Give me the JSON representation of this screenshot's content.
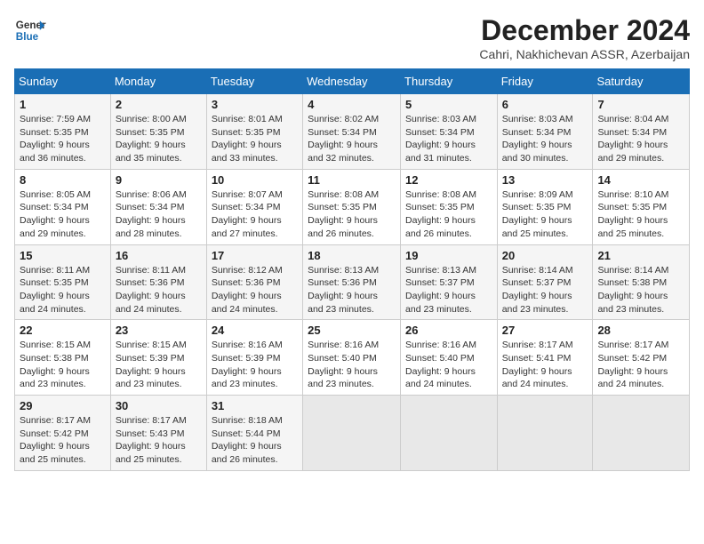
{
  "logo": {
    "line1": "General",
    "line2": "Blue"
  },
  "title": "December 2024",
  "location": "Cahri, Nakhichevan ASSR, Azerbaijan",
  "headers": [
    "Sunday",
    "Monday",
    "Tuesday",
    "Wednesday",
    "Thursday",
    "Friday",
    "Saturday"
  ],
  "weeks": [
    [
      {
        "day": "1",
        "info": "Sunrise: 7:59 AM\nSunset: 5:35 PM\nDaylight: 9 hours\nand 36 minutes."
      },
      {
        "day": "2",
        "info": "Sunrise: 8:00 AM\nSunset: 5:35 PM\nDaylight: 9 hours\nand 35 minutes."
      },
      {
        "day": "3",
        "info": "Sunrise: 8:01 AM\nSunset: 5:35 PM\nDaylight: 9 hours\nand 33 minutes."
      },
      {
        "day": "4",
        "info": "Sunrise: 8:02 AM\nSunset: 5:34 PM\nDaylight: 9 hours\nand 32 minutes."
      },
      {
        "day": "5",
        "info": "Sunrise: 8:03 AM\nSunset: 5:34 PM\nDaylight: 9 hours\nand 31 minutes."
      },
      {
        "day": "6",
        "info": "Sunrise: 8:03 AM\nSunset: 5:34 PM\nDaylight: 9 hours\nand 30 minutes."
      },
      {
        "day": "7",
        "info": "Sunrise: 8:04 AM\nSunset: 5:34 PM\nDaylight: 9 hours\nand 29 minutes."
      }
    ],
    [
      {
        "day": "8",
        "info": "Sunrise: 8:05 AM\nSunset: 5:34 PM\nDaylight: 9 hours\nand 29 minutes."
      },
      {
        "day": "9",
        "info": "Sunrise: 8:06 AM\nSunset: 5:34 PM\nDaylight: 9 hours\nand 28 minutes."
      },
      {
        "day": "10",
        "info": "Sunrise: 8:07 AM\nSunset: 5:34 PM\nDaylight: 9 hours\nand 27 minutes."
      },
      {
        "day": "11",
        "info": "Sunrise: 8:08 AM\nSunset: 5:35 PM\nDaylight: 9 hours\nand 26 minutes."
      },
      {
        "day": "12",
        "info": "Sunrise: 8:08 AM\nSunset: 5:35 PM\nDaylight: 9 hours\nand 26 minutes."
      },
      {
        "day": "13",
        "info": "Sunrise: 8:09 AM\nSunset: 5:35 PM\nDaylight: 9 hours\nand 25 minutes."
      },
      {
        "day": "14",
        "info": "Sunrise: 8:10 AM\nSunset: 5:35 PM\nDaylight: 9 hours\nand 25 minutes."
      }
    ],
    [
      {
        "day": "15",
        "info": "Sunrise: 8:11 AM\nSunset: 5:35 PM\nDaylight: 9 hours\nand 24 minutes."
      },
      {
        "day": "16",
        "info": "Sunrise: 8:11 AM\nSunset: 5:36 PM\nDaylight: 9 hours\nand 24 minutes."
      },
      {
        "day": "17",
        "info": "Sunrise: 8:12 AM\nSunset: 5:36 PM\nDaylight: 9 hours\nand 24 minutes."
      },
      {
        "day": "18",
        "info": "Sunrise: 8:13 AM\nSunset: 5:36 PM\nDaylight: 9 hours\nand 23 minutes."
      },
      {
        "day": "19",
        "info": "Sunrise: 8:13 AM\nSunset: 5:37 PM\nDaylight: 9 hours\nand 23 minutes."
      },
      {
        "day": "20",
        "info": "Sunrise: 8:14 AM\nSunset: 5:37 PM\nDaylight: 9 hours\nand 23 minutes."
      },
      {
        "day": "21",
        "info": "Sunrise: 8:14 AM\nSunset: 5:38 PM\nDaylight: 9 hours\nand 23 minutes."
      }
    ],
    [
      {
        "day": "22",
        "info": "Sunrise: 8:15 AM\nSunset: 5:38 PM\nDaylight: 9 hours\nand 23 minutes."
      },
      {
        "day": "23",
        "info": "Sunrise: 8:15 AM\nSunset: 5:39 PM\nDaylight: 9 hours\nand 23 minutes."
      },
      {
        "day": "24",
        "info": "Sunrise: 8:16 AM\nSunset: 5:39 PM\nDaylight: 9 hours\nand 23 minutes."
      },
      {
        "day": "25",
        "info": "Sunrise: 8:16 AM\nSunset: 5:40 PM\nDaylight: 9 hours\nand 23 minutes."
      },
      {
        "day": "26",
        "info": "Sunrise: 8:16 AM\nSunset: 5:40 PM\nDaylight: 9 hours\nand 24 minutes."
      },
      {
        "day": "27",
        "info": "Sunrise: 8:17 AM\nSunset: 5:41 PM\nDaylight: 9 hours\nand 24 minutes."
      },
      {
        "day": "28",
        "info": "Sunrise: 8:17 AM\nSunset: 5:42 PM\nDaylight: 9 hours\nand 24 minutes."
      }
    ],
    [
      {
        "day": "29",
        "info": "Sunrise: 8:17 AM\nSunset: 5:42 PM\nDaylight: 9 hours\nand 25 minutes."
      },
      {
        "day": "30",
        "info": "Sunrise: 8:17 AM\nSunset: 5:43 PM\nDaylight: 9 hours\nand 25 minutes."
      },
      {
        "day": "31",
        "info": "Sunrise: 8:18 AM\nSunset: 5:44 PM\nDaylight: 9 hours\nand 26 minutes."
      },
      {
        "day": "",
        "info": ""
      },
      {
        "day": "",
        "info": ""
      },
      {
        "day": "",
        "info": ""
      },
      {
        "day": "",
        "info": ""
      }
    ]
  ]
}
